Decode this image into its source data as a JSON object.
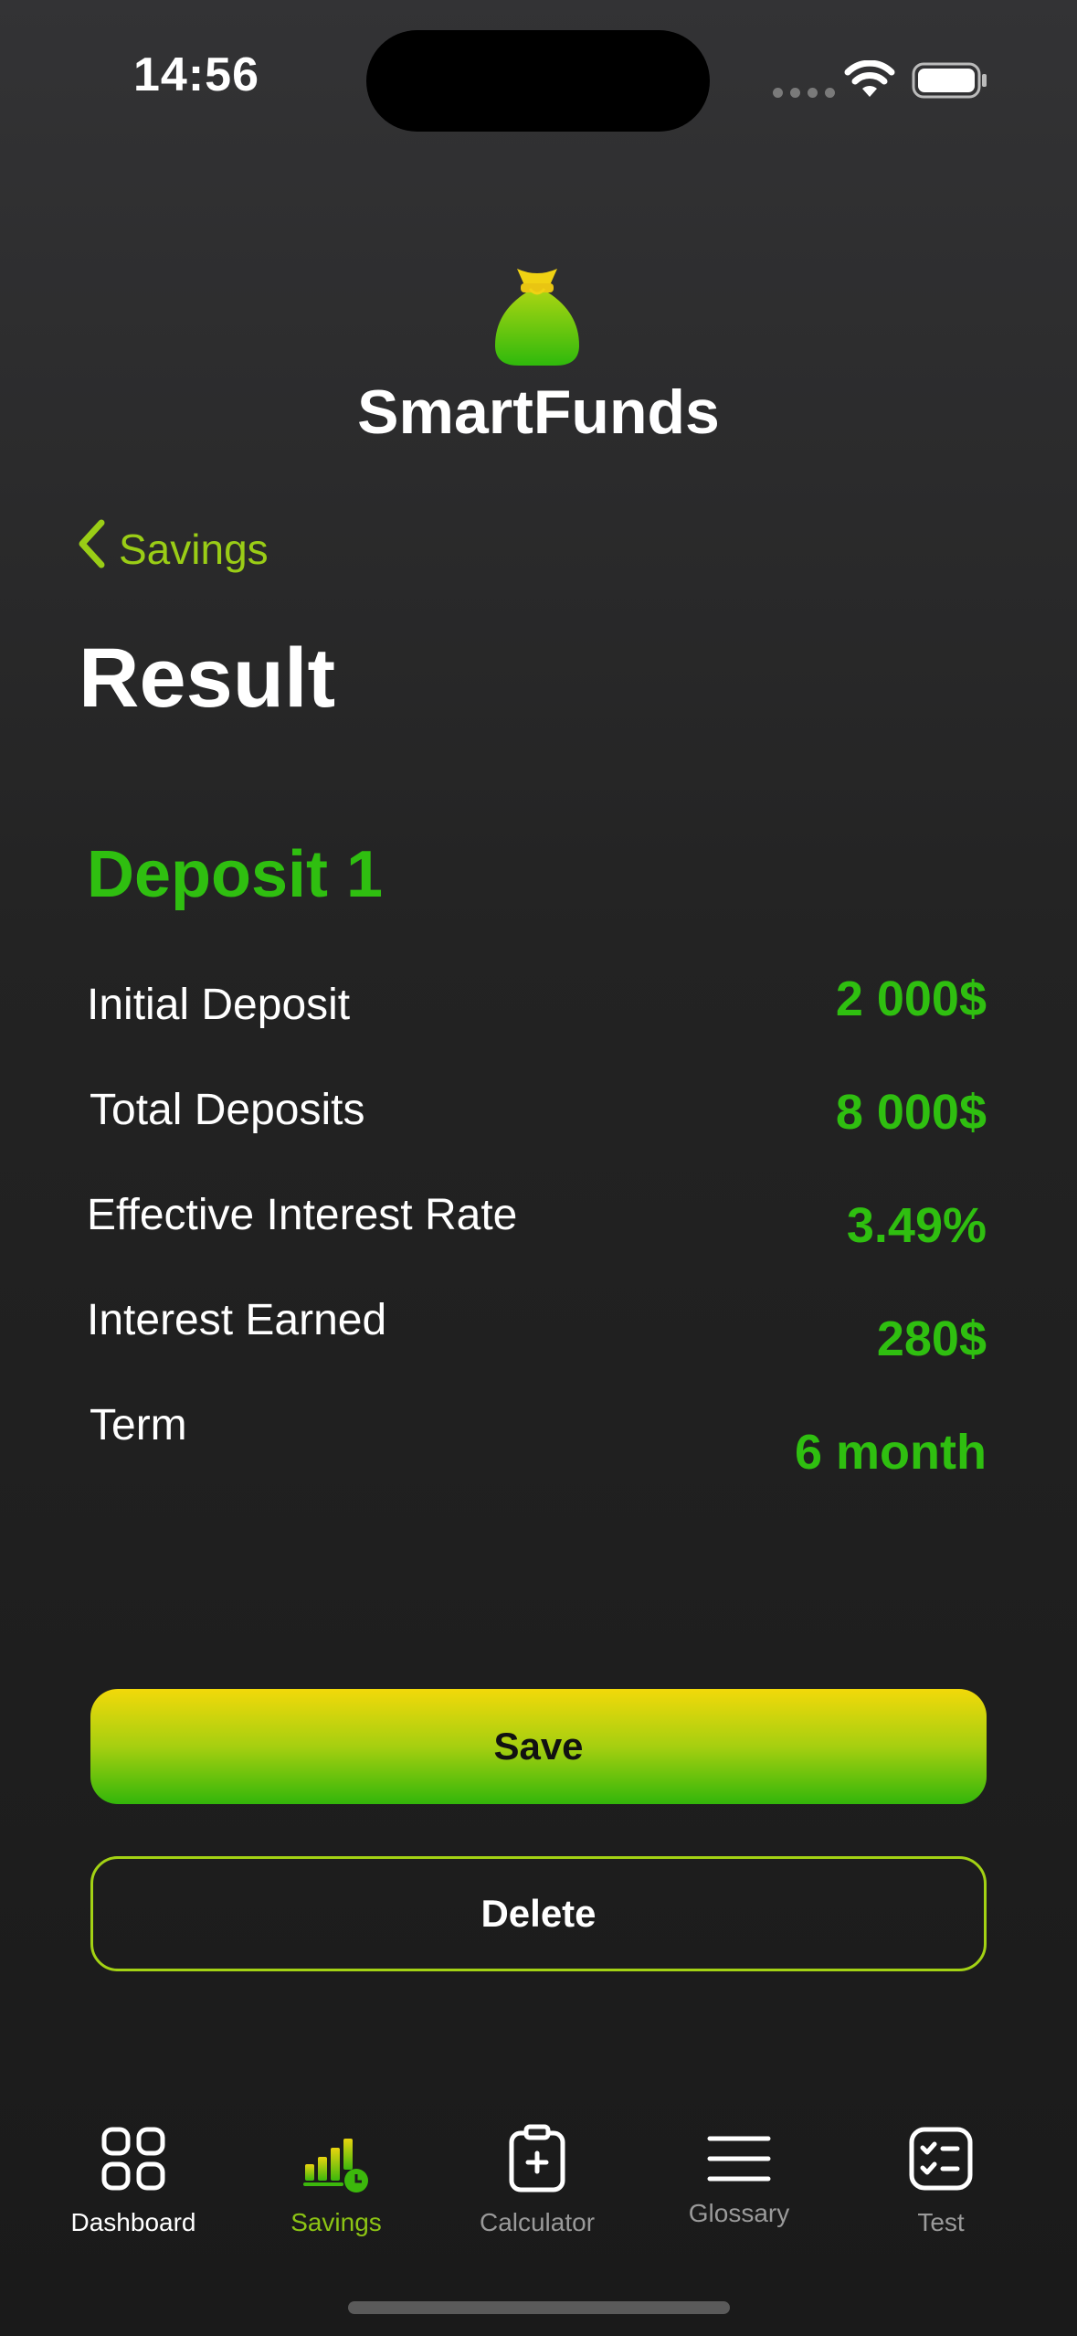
{
  "status_bar": {
    "time": "14:56"
  },
  "app": {
    "name": "SmartFunds"
  },
  "nav": {
    "back_label": "Savings"
  },
  "page": {
    "title": "Result"
  },
  "deposit": {
    "title": "Deposit 1",
    "rows": [
      {
        "label": "Initial Deposit",
        "value": "2 000$"
      },
      {
        "label": "Total Deposits",
        "value": "8 000$"
      },
      {
        "label": "Effective Interest Rate",
        "value": "3.49%"
      },
      {
        "label": "Interest Earned",
        "value": "280$"
      },
      {
        "label": "Term",
        "value": "6 month"
      }
    ]
  },
  "actions": {
    "save_label": "Save",
    "delete_label": "Delete"
  },
  "tab_bar": {
    "tabs": [
      {
        "label": "Dashboard",
        "icon": "grid-icon",
        "active": false
      },
      {
        "label": "Savings",
        "icon": "chart-coin-icon",
        "active": true
      },
      {
        "label": "Calculator",
        "icon": "clipboard-plus-icon",
        "active": false
      },
      {
        "label": "Glossary",
        "icon": "menu-lines-icon",
        "active": false
      },
      {
        "label": "Test",
        "icon": "checklist-icon",
        "active": false
      }
    ]
  },
  "colors": {
    "accent_green": "#2fbf10",
    "accent_yellow": "#f2d90a",
    "back_green": "#9acd16",
    "inactive_gray": "#9a9a9a"
  }
}
